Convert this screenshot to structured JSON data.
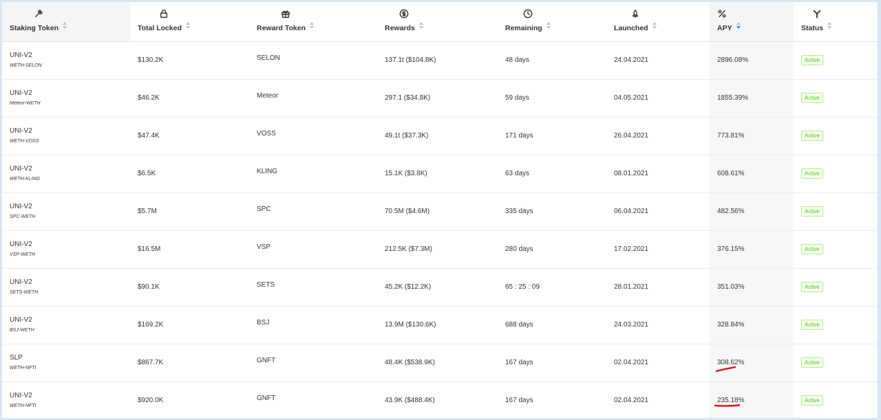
{
  "columns": [
    {
      "key": "staking",
      "label": "Staking Token",
      "icon": "fork-icon"
    },
    {
      "key": "locked",
      "label": "Total Locked",
      "icon": "lock-icon"
    },
    {
      "key": "reward",
      "label": "Reward Token",
      "icon": "gift-icon"
    },
    {
      "key": "rewards",
      "label": "Rewards",
      "icon": "dollar-icon"
    },
    {
      "key": "remaining",
      "label": "Remaining",
      "icon": "clock-icon"
    },
    {
      "key": "launched",
      "label": "Launched",
      "icon": "rocket-icon"
    },
    {
      "key": "apy",
      "label": "APY",
      "icon": "percent-icon"
    },
    {
      "key": "status",
      "label": "Status",
      "icon": "branch-icon"
    }
  ],
  "rows": [
    {
      "token": "UNI-V2",
      "pair": "WETH-SELON",
      "locked": "$130.2K",
      "reward": "SELON",
      "rewards": "137.1t ($104.8K)",
      "remaining": "48 days",
      "launched": "24.04.2021",
      "apy": "2896.08%",
      "status": "Active"
    },
    {
      "token": "UNI-V2",
      "pair": "Meteor-WETH",
      "locked": "$46.2K",
      "reward": "Meteor",
      "rewards": "297.1 ($34.8K)",
      "remaining": "59 days",
      "launched": "04.05.2021",
      "apy": "1855.39%",
      "status": "Active"
    },
    {
      "token": "UNI-V2",
      "pair": "WETH-VOSS",
      "locked": "$47.4K",
      "reward": "VOSS",
      "rewards": "49.1t ($37.3K)",
      "remaining": "171 days",
      "launched": "26.04.2021",
      "apy": "773.81%",
      "status": "Active"
    },
    {
      "token": "UNI-V2",
      "pair": "WETH-KLING",
      "locked": "$6.5K",
      "reward": "KLING",
      "rewards": "15.1K ($3.8K)",
      "remaining": "63 days",
      "launched": "08.01.2021",
      "apy": "608.61%",
      "status": "Active"
    },
    {
      "token": "UNI-V2",
      "pair": "SPC-WETH",
      "locked": "$5.7M",
      "reward": "SPC",
      "rewards": "70.5M ($4.6M)",
      "remaining": "335 days",
      "launched": "06.04.2021",
      "apy": "482.56%",
      "status": "Active"
    },
    {
      "token": "UNI-V2",
      "pair": "VSP-WETH",
      "locked": "$16.5M",
      "reward": "VSP",
      "rewards": "212.5K ($7.3M)",
      "remaining": "280 days",
      "launched": "17.02.2021",
      "apy": "376.15%",
      "status": "Active"
    },
    {
      "token": "UNI-V2",
      "pair": "SETS-WETH",
      "locked": "$90.1K",
      "reward": "SETS",
      "rewards": "45.2K ($12.2K)",
      "remaining": "65 : 25 : 09",
      "launched": "28.01.2021",
      "apy": "351.03%",
      "status": "Active"
    },
    {
      "token": "UNI-V2",
      "pair": "BSJ-WETH",
      "locked": "$169.2K",
      "reward": "BSJ",
      "rewards": "13.9M ($130.6K)",
      "remaining": "688 days",
      "launched": "24.03.2021",
      "apy": "328.84%",
      "status": "Active"
    },
    {
      "token": "SLP",
      "pair": "WETH-NFTI",
      "locked": "$867.7K",
      "reward": "GNFT",
      "rewards": "48.4K ($538.9K)",
      "remaining": "167 days",
      "launched": "02.04.2021",
      "apy": "308.62%",
      "status": "Active"
    },
    {
      "token": "UNI-V2",
      "pair": "WETH-NFTI",
      "locked": "$920.0K",
      "reward": "GNFT",
      "rewards": "43.9K ($488.4K)",
      "remaining": "167 days",
      "launched": "02.04.2021",
      "apy": "235.18%",
      "status": "Active"
    }
  ],
  "colors": {
    "accent": "#1890ff",
    "active_green": "#52c41a",
    "annotation_red": "#e0101e"
  }
}
